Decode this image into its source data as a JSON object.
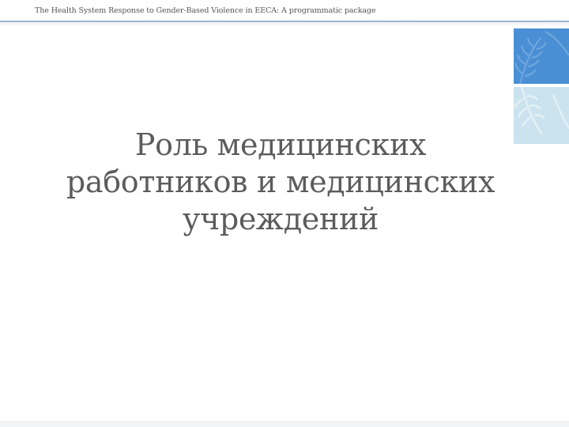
{
  "header": {
    "text": "The Health System Response to Gender-Based Violence in EECA: A programmatic package"
  },
  "slide": {
    "title_lines": [
      "Роль медицинских",
      "работников и медицинских",
      "учреждений"
    ]
  },
  "logo": {
    "icon": "un-laurel-emblem-icon",
    "colors": {
      "top": "#4a8fd4",
      "bottom": "#cbe3ee"
    }
  }
}
